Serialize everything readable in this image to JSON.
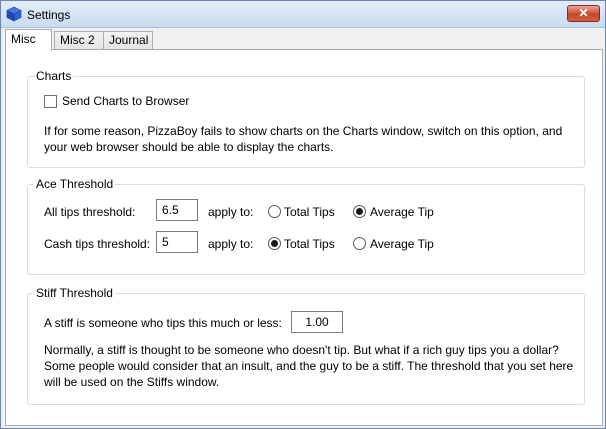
{
  "window": {
    "title": "Settings",
    "close_glyph": "✕"
  },
  "tabs": [
    {
      "label": "Misc",
      "active": true
    },
    {
      "label": "Misc 2",
      "active": false
    },
    {
      "label": "Journal",
      "active": false
    }
  ],
  "charts": {
    "title": "Charts",
    "checkbox_label": "Send Charts to Browser",
    "checkbox_checked": false,
    "description": "If for some reason, PizzaBoy fails to show charts on the Charts window, switch on this option, and your web browser should be able to display the charts."
  },
  "ace": {
    "title": "Ace Threshold",
    "all_label": "All tips threshold:",
    "all_value": "6.5",
    "cash_label": "Cash tips threshold:",
    "cash_value": "5",
    "apply_to_label": "apply to:",
    "option_total": "Total Tips",
    "option_average": "Average Tip",
    "all_selected": "average",
    "cash_selected": "total"
  },
  "stiff": {
    "title": "Stiff Threshold",
    "label": "A stiff is someone who tips this much or less:",
    "value": "1.00",
    "description": "Normally, a stiff is thought to be someone who doesn't tip. But what if a rich guy tips you a dollar? Some people would consider that an insult, and the guy to be a stiff. The threshold that you set here will be used on the Stiffs window."
  },
  "icons": {
    "app": "settings-cube-icon",
    "close": "close-icon"
  },
  "colors": {
    "title_gradient_top": "#e3edf8",
    "close_red": "#c7452c",
    "group_border": "#d5dfe5"
  }
}
